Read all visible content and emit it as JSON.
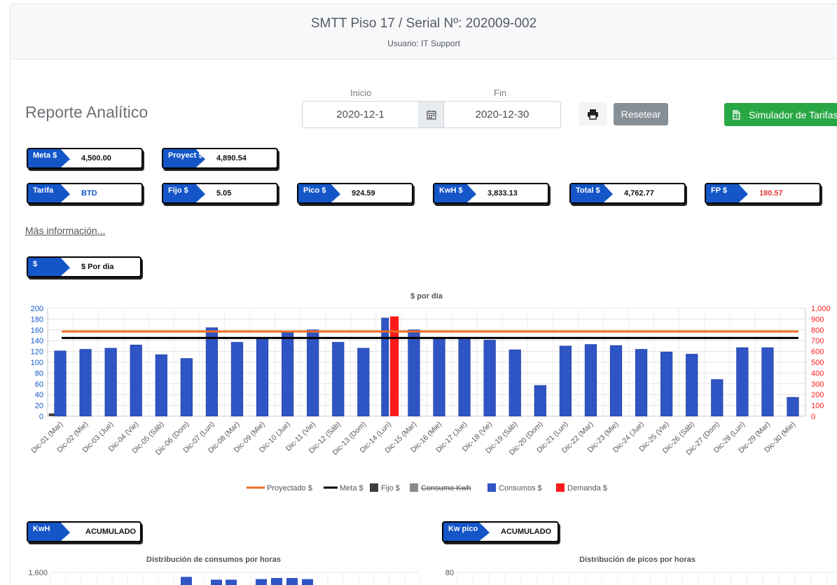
{
  "header": {
    "title": "SMTT Piso 17 / Serial Nº: 202009-002",
    "user": "Usuario: IT Support"
  },
  "page_title": "Reporte Analítico",
  "dates": {
    "start_label": "Inicio",
    "start_value": "2020-12-1",
    "end_label": "Fin",
    "end_value": "2020-12-30"
  },
  "toolbar": {
    "print_icon": "print-icon",
    "reset_label": "Resetear",
    "simulator_label": "Simulador de Tarifas",
    "simulator_icon": "spreadsheet-icon"
  },
  "kpis_row1": [
    {
      "tag": "Meta $",
      "value": "4,500.00"
    },
    {
      "tag": "Proyect $",
      "value": "4,890.54"
    }
  ],
  "kpis_row2": [
    {
      "tag": "Tarifa",
      "value": "BTD"
    },
    {
      "tag": "Fijo $",
      "value": "5.05"
    },
    {
      "tag": "Pico $",
      "value": "924.59"
    },
    {
      "tag": "KwH $",
      "value": "3,833.13"
    },
    {
      "tag": "Total $",
      "value": "4,762.77"
    },
    {
      "tag": "FP $",
      "value": "180.57"
    }
  ],
  "colors": {
    "tag_bg": "#1456c8",
    "btd": "#1456c8",
    "fp_value": "#e53935",
    "bars": "#2f55c4",
    "demanda": "#ff1a1a",
    "proyectado": "#f26b21",
    "meta": "#000000",
    "reset": "#868e96",
    "simulator": "#28a745"
  },
  "more_info": "Más información...",
  "selector": {
    "tag": "$",
    "value": "$ Por dia"
  },
  "chart_data": [
    {
      "type": "bar",
      "title": "$ por día",
      "ylim": [
        0,
        200
      ],
      "y_ticks": [
        0,
        20,
        40,
        60,
        80,
        100,
        120,
        140,
        160,
        180,
        200
      ],
      "y2lim": [
        0,
        1000
      ],
      "y2_ticks": [
        "0",
        "100",
        "200",
        "300",
        "400",
        "500",
        "600",
        "700",
        "800",
        "900",
        "1,000"
      ],
      "categories": [
        "Dic-01 (Mar)",
        "Dic-02 (Mie)",
        "Dic-03 (Jue)",
        "Dic-04 (Vie)",
        "Dic-05 (Sáb)",
        "Dic-06 (Dom)",
        "Dic-07 (Lun)",
        "Dic-08 (Mar)",
        "Dic-09 (Mie)",
        "Dic-10 (Jue)",
        "Dic-11 (Vie)",
        "Dic-12 (Sáb)",
        "Dic-13 (Dom)",
        "Dic-14 (Lun)",
        "Dic-15 (Mar)",
        "Dic-16 (Mie)",
        "Dic-17 (Jue)",
        "Dic-18 (Vie)",
        "Dic-19 (Sáb)",
        "Dic-20 (Dom)",
        "Dic-21 (Lun)",
        "Dic-22 (Mar)",
        "Dic-23 (Mie)",
        "Dic-24 (Jue)",
        "Dic-25 (Vie)",
        "Dic-26 (Sáb)",
        "Dic-27 (Dom)",
        "Dic-28 (Lun)",
        "Dic-29 (Mar)",
        "Dic-30 (Mie)"
      ],
      "series": [
        {
          "name": "Proyectado $",
          "kind": "line",
          "value": 157
        },
        {
          "name": "Meta $",
          "kind": "line",
          "value": 145
        },
        {
          "name": "Fijo $",
          "kind": "bar",
          "values": [
            5,
            0,
            0,
            0,
            0,
            0,
            0,
            0,
            0,
            0,
            0,
            0,
            0,
            0,
            0,
            0,
            0,
            0,
            0,
            0,
            0,
            0,
            0,
            0,
            0,
            0,
            0,
            0,
            0,
            0
          ]
        },
        {
          "name": "Consumo Kwh",
          "kind": "bar",
          "hidden": true
        },
        {
          "name": "Consumos $",
          "kind": "bar",
          "values": [
            121,
            124,
            126,
            132,
            114,
            107,
            164,
            137,
            145,
            158,
            160,
            137,
            126,
            182,
            160,
            146,
            146,
            141,
            123,
            57,
            130,
            133,
            131,
            124,
            119,
            115,
            68,
            127,
            127,
            35
          ]
        },
        {
          "name": "Demanda $",
          "kind": "bar",
          "axis": "right",
          "values": [
            0,
            0,
            0,
            0,
            0,
            0,
            0,
            0,
            0,
            0,
            0,
            0,
            0,
            924.59,
            0,
            0,
            0,
            0,
            0,
            0,
            0,
            0,
            0,
            0,
            0,
            0,
            0,
            0,
            0,
            0
          ]
        }
      ],
      "legend": [
        "Proyectado $",
        "Meta $",
        "Fijo $",
        "Consumo Kwh",
        "Consumos $",
        "Demanda $"
      ],
      "legend_position": "bottom"
    },
    {
      "type": "bar",
      "title": "Distribución de consumos por horas",
      "y_ticks": [
        "1,600"
      ],
      "values_visible_top": [
        1570,
        1520,
        1520,
        1530,
        1550,
        1550,
        1530
      ]
    },
    {
      "type": "bar",
      "title": "Distribución de picos por horas",
      "y_ticks": [
        "80"
      ]
    }
  ],
  "bottom_selectors": [
    {
      "tag": "KwH",
      "value": "ACUMULADO"
    },
    {
      "tag": "Kw pico",
      "value": "ACUMULADO"
    }
  ]
}
